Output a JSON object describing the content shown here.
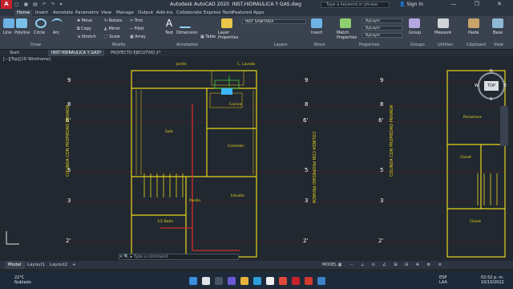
{
  "app": {
    "logo": "A",
    "title": "Autodesk AutoCAD 2020",
    "file": "INST.HIDRAULICA Y GAS.dwg",
    "search_placeholder": "Type a keyword or phrase",
    "sign_in": "Sign In"
  },
  "ribbon_tabs": [
    "Home",
    "Insert",
    "Annotate",
    "Parametric",
    "View",
    "Manage",
    "Output",
    "Add-ins",
    "Collaborate",
    "Express Tools",
    "Featured Apps"
  ],
  "ribbon": {
    "draw": {
      "line": "Line",
      "polyline": "Polyline",
      "circle": "Circle",
      "arc": "Arc",
      "panel": "Draw"
    },
    "modify": {
      "move": "Move",
      "rotate": "Rotate",
      "trim": "Trim",
      "copy": "Copy",
      "mirror": "Mirror",
      "fillet": "Fillet",
      "stretch": "Stretch",
      "scale": "Scale",
      "array": "Array",
      "panel": "Modify"
    },
    "annotation": {
      "text": "Text",
      "dimension": "Dimension",
      "table": "Table",
      "panel": "Annotation"
    },
    "layers": {
      "layer_properties": "Layer Properties",
      "current_layer": "INST SANITARIA",
      "panel": "Layers"
    },
    "block": {
      "insert": "Insert",
      "panel": "Block"
    },
    "properties": {
      "match": "Match Properties",
      "bylayer1": "ByLayer",
      "bylayer2": "ByLayer",
      "bylayer3": "ByLayer",
      "panel": "Properties"
    },
    "groups": {
      "group": "Group",
      "panel": "Groups"
    },
    "utilities": {
      "measure": "Measure",
      "panel": "Utilities"
    },
    "clipboard": {
      "paste": "Paste",
      "panel": "Clipboard"
    },
    "view": {
      "base": "Base",
      "panel": "View"
    }
  },
  "file_tabs": [
    "Start",
    "INST.HIDRAULICA Y GAS*",
    "PROYECTO EJECUTIVO 2*"
  ],
  "viewport": {
    "controls": "[−][Top][2D Wireframe]",
    "viewcube_top": "TOP",
    "viewcube_n": "N",
    "viewcube_s": "S",
    "viewcube_w": "W",
    "viewcube_e": "E",
    "wcs": "WCS"
  },
  "plan": {
    "grid_left": [
      "9",
      "8",
      "6'",
      "5",
      "3",
      "2'"
    ],
    "grid_right": [
      "9",
      "8",
      "6'",
      "5",
      "3",
      "2'"
    ],
    "vertical_text": "COLINDA CON PROPIEDAD PRIVADA",
    "rooms": [
      "Jardín",
      "C. Lavado",
      "Cocina",
      "Sala",
      "Comedor",
      "Estudio",
      "1/2 Baño",
      "Pasillo",
      "Recamara",
      "Closet",
      "Closet"
    ]
  },
  "command": {
    "placeholder": "Type a command"
  },
  "layout_tabs": [
    "Model",
    "Layout1",
    "Layout2",
    "+"
  ],
  "status_bar": {
    "model": "MODEL"
  },
  "taskbar": {
    "temp": "22°C",
    "weather": "Nublado",
    "lang": "ESP",
    "lang2": "LAA",
    "time": "02:52 p. m.",
    "date": "10/10/2022"
  },
  "colors": {
    "accent": "#c5222c",
    "drawing_yellow": "#e9d51b",
    "grid_white": "#e6e6e6",
    "background": "#212830"
  }
}
